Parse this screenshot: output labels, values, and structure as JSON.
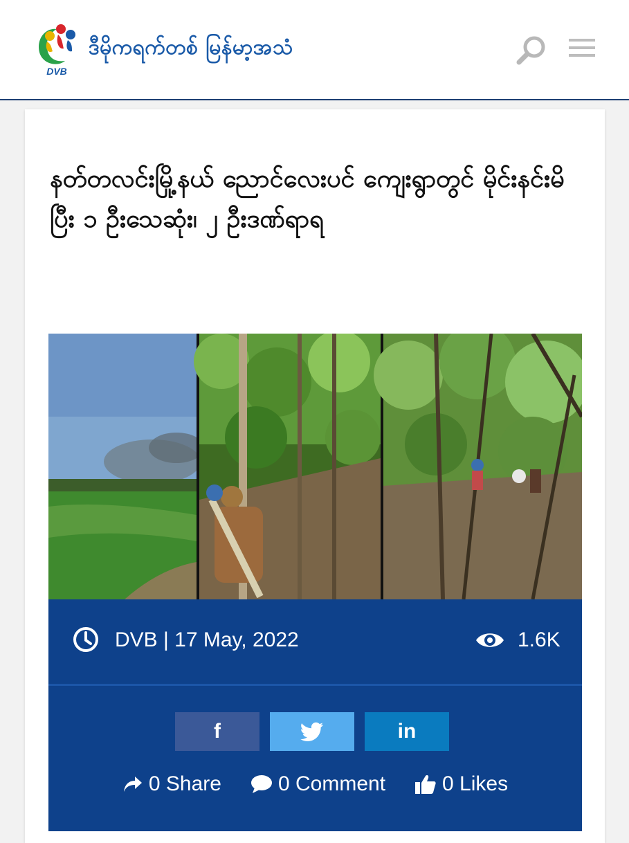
{
  "header": {
    "logo_text": "DVB",
    "brand_text": "ဒီမိုကရက်တစ် မြန်မာ့အသံ"
  },
  "article": {
    "title": "နတ်တလင်းမြို့နယ် ညောင်လေးပင် ကျေးရွာတွင် မိုင်းနင်းမိပြီး ၁ ဦးသေဆုံး၊ ၂ ဦးဒဏ်ရာရ",
    "meta": {
      "author_date": "DVB | 17 May, 2022",
      "views": "1.6K"
    }
  },
  "share_buttons": {
    "facebook": "f",
    "linkedin": "in"
  },
  "stats": {
    "share": "0 Share",
    "comment": "0 Comment",
    "likes": "0 Likes"
  },
  "icons": [
    "dvb-logo-icon",
    "search-icon",
    "hamburger-menu-icon",
    "clock-icon",
    "eye-icon",
    "twitter-icon",
    "share-arrow-icon",
    "comment-icon",
    "thumbs-up-icon"
  ],
  "colors": {
    "brand_blue": "#1a5aa8",
    "meta_bar": "#0e418b",
    "facebook": "#3b5998",
    "twitter": "#55acee",
    "linkedin": "#0a7bbf"
  }
}
